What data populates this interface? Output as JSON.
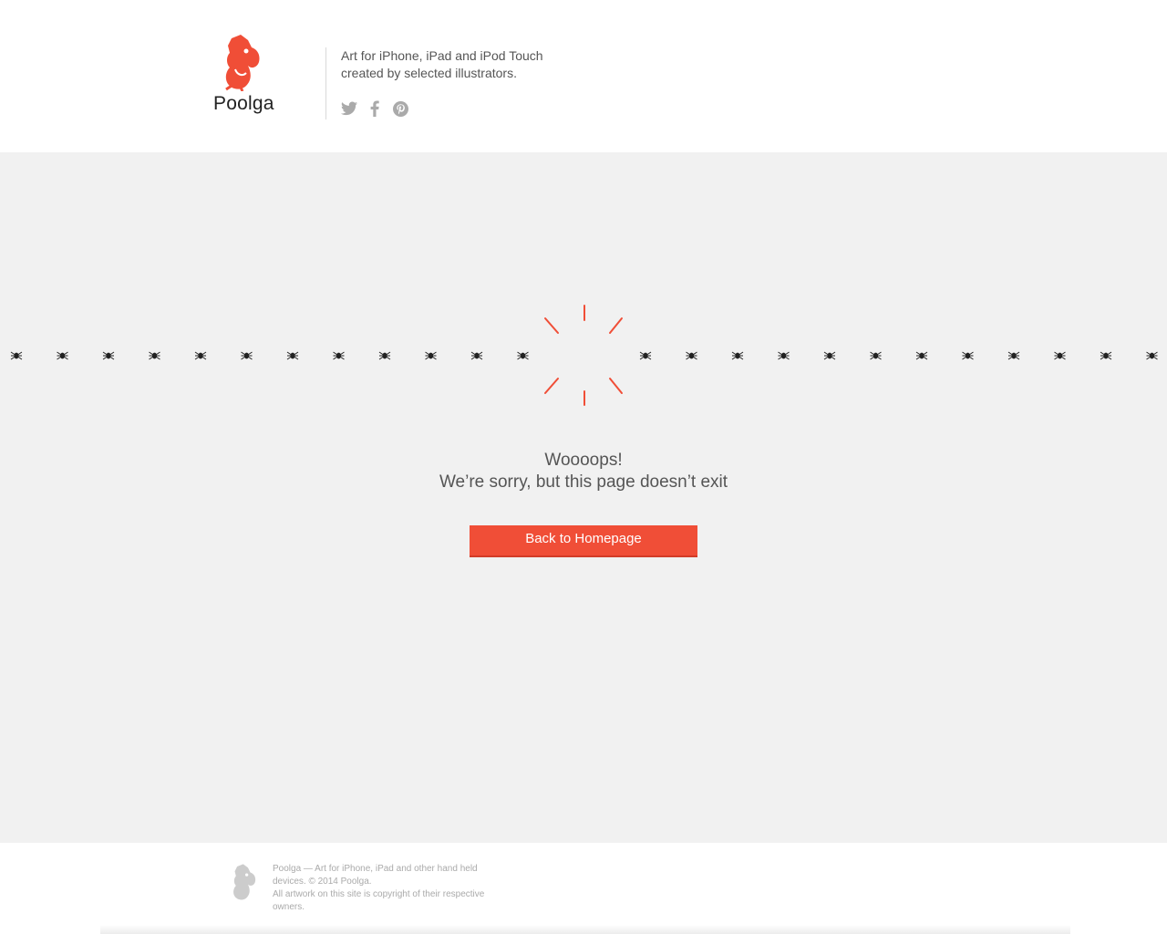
{
  "header": {
    "brand": "Poolga",
    "tagline_line1": "Art for iPhone, iPad and iPod Touch",
    "tagline_line2": "created by selected illustrators.",
    "social": [
      "twitter-icon",
      "facebook-icon",
      "pinterest-icon"
    ]
  },
  "error": {
    "title": "Woooops!",
    "message": "We’re sorry, but this page doesn’t exit",
    "button_label": "Back to Homepage"
  },
  "footer": {
    "line1": "Poolga — Art for iPhone, iPad and other hand held devices. © 2014 Poolga.",
    "line2": "All artwork on this site is copyright of their respective owners."
  },
  "colors": {
    "accent": "#f04e37",
    "background": "#f1f1f1",
    "text": "#555555",
    "icon": "#aaaaaa"
  }
}
